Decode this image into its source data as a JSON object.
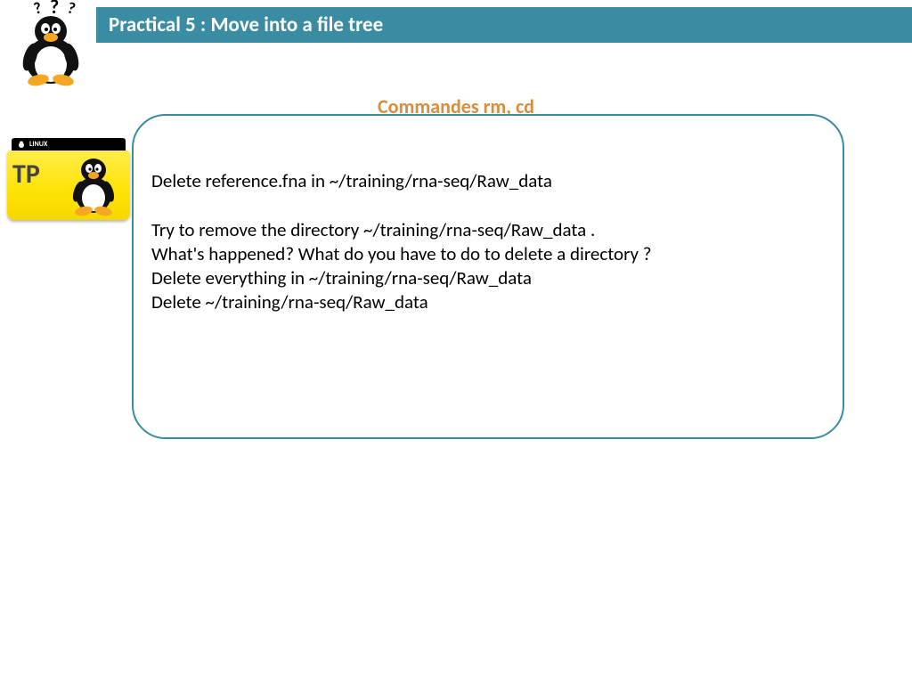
{
  "header": {
    "title": "Practical 5 : Move into a file tree"
  },
  "subtitle": "Commandes rm, cd",
  "content": {
    "line1": "Delete reference.fna in ~/training/rna-seq/Raw_data",
    "line2": "Try to remove the directory ~/training/rna-seq/Raw_data .",
    "line3": "What's happened? What do you have to do to delete a directory ?",
    "line4": "Delete everything in ~/training/rna-seq/Raw_data",
    "line5": "Delete ~/training/rna-seq/Raw_data"
  },
  "folder": {
    "tab_label": "LINUX",
    "tp_label": "TP"
  }
}
